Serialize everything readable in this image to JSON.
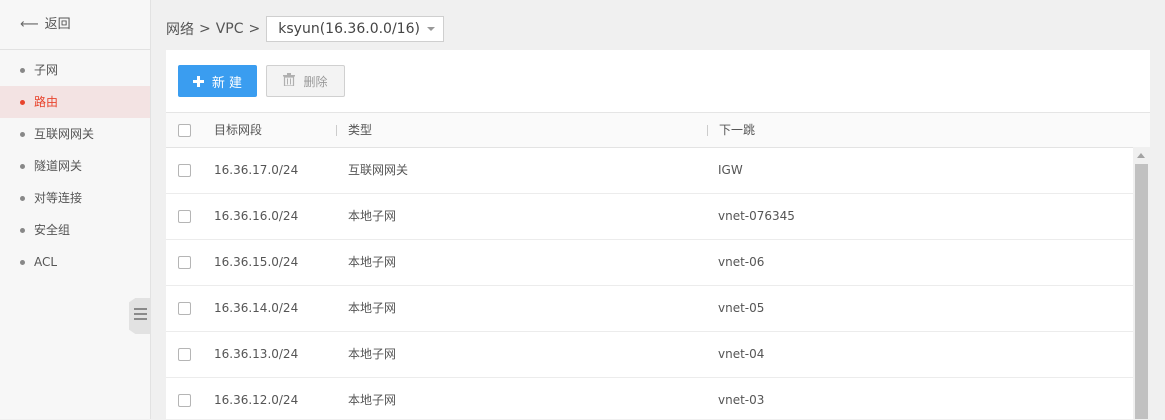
{
  "sidebar": {
    "back_label": "返回",
    "items": [
      {
        "label": "子网",
        "active": false
      },
      {
        "label": "路由",
        "active": true
      },
      {
        "label": "互联网网关",
        "active": false
      },
      {
        "label": "隧道网关",
        "active": false
      },
      {
        "label": "对等连接",
        "active": false
      },
      {
        "label": "安全组",
        "active": false
      },
      {
        "label": "ACL",
        "active": false
      }
    ]
  },
  "breadcrumb": {
    "level1": "网络",
    "separator": ">",
    "level2": "VPC",
    "vpc_selected": "ksyun(16.36.0.0/16)"
  },
  "toolbar": {
    "new_label": "新 建",
    "delete_label": "删除"
  },
  "table": {
    "columns": [
      "目标网段",
      "类型",
      "下一跳"
    ],
    "rows": [
      {
        "cidr": "16.36.17.0/24",
        "type": "互联网网关",
        "next_hop": "IGW"
      },
      {
        "cidr": "16.36.16.0/24",
        "type": "本地子网",
        "next_hop": "vnet-076345"
      },
      {
        "cidr": "16.36.15.0/24",
        "type": "本地子网",
        "next_hop": "vnet-06"
      },
      {
        "cidr": "16.36.14.0/24",
        "type": "本地子网",
        "next_hop": "vnet-05"
      },
      {
        "cidr": "16.36.13.0/24",
        "type": "本地子网",
        "next_hop": "vnet-04"
      },
      {
        "cidr": "16.36.12.0/24",
        "type": "本地子网",
        "next_hop": "vnet-03"
      }
    ]
  },
  "colors": {
    "primary": "#3a9df0",
    "active_nav": "#e8442d",
    "active_nav_bg": "#f3e3e3"
  },
  "icons": {
    "back": "arrow-left-icon",
    "new": "plus-icon",
    "delete": "trash-icon",
    "collapse": "menu-icon"
  }
}
